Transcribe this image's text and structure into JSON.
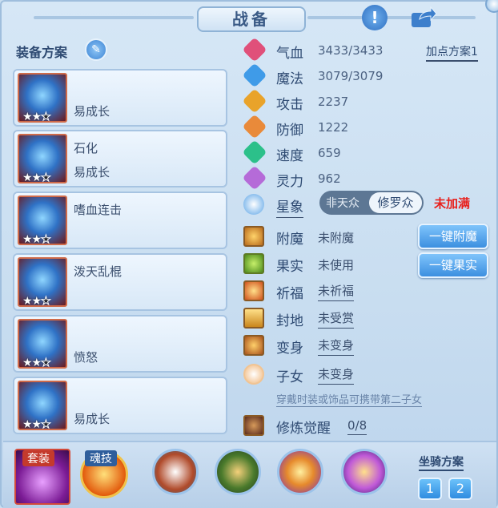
{
  "window": {
    "title": "战备"
  },
  "left": {
    "heading": "装备方案",
    "slots": [
      {
        "line1": "",
        "line2": "易成长",
        "stars_on": 2,
        "stars_total": 3
      },
      {
        "line1": "石化",
        "line2": "易成长",
        "stars_on": 2,
        "stars_total": 3
      },
      {
        "line1": "嗜血连击",
        "line2": "",
        "stars_on": 2,
        "stars_total": 3
      },
      {
        "line1": "泼天乱棍",
        "line2": "",
        "stars_on": 2,
        "stars_total": 3
      },
      {
        "line1": "",
        "line2": "愤怒",
        "stars_on": 2,
        "stars_total": 3
      },
      {
        "line1": "",
        "line2": "易成长",
        "stars_on": 2,
        "stars_total": 3
      }
    ]
  },
  "stats": {
    "plus_plan": "加点方案1",
    "items": [
      {
        "label": "气血",
        "value": "3433/3433",
        "color": "#e0507a",
        "icon": "heart-icon"
      },
      {
        "label": "魔法",
        "value": "3079/3079",
        "color": "#3f9be8",
        "icon": "mana-icon"
      },
      {
        "label": "攻击",
        "value": "2237",
        "color": "#e9a32a",
        "icon": "sword-icon"
      },
      {
        "label": "防御",
        "value": "1222",
        "color": "#e98a3a",
        "icon": "shield-icon"
      },
      {
        "label": "速度",
        "value": "659",
        "color": "#2cc08a",
        "icon": "speed-icon"
      },
      {
        "label": "灵力",
        "value": "962",
        "color": "#b56bd8",
        "icon": "spirit-icon"
      }
    ],
    "constellation": {
      "label": "星象",
      "opt_a": "非天众",
      "opt_b": "修罗众",
      "status": "未加满"
    }
  },
  "enhance": {
    "items": [
      {
        "label": "附魔",
        "value": "未附魔",
        "underline": false
      },
      {
        "label": "果实",
        "value": "未使用",
        "underline": false
      },
      {
        "label": "祈福",
        "value": "未祈福",
        "underline": true
      },
      {
        "label": "封地",
        "value": "未受赏",
        "underline": true
      },
      {
        "label": "变身",
        "value": "未变身",
        "underline": true
      },
      {
        "label": "子女",
        "value": "未变身",
        "underline": true
      }
    ],
    "btn_enchant": "一键附魔",
    "btn_fruit": "一键果实",
    "hint": "穿戴时装或饰品可携带第二子女",
    "awaken_label": "修炼觉醒",
    "awaken_value": "0/8"
  },
  "bottom": {
    "set_tag": "套装",
    "soul_tag": "魂技",
    "mount_label": "坐骑方案",
    "mount_1": "1",
    "mount_2": "2"
  }
}
